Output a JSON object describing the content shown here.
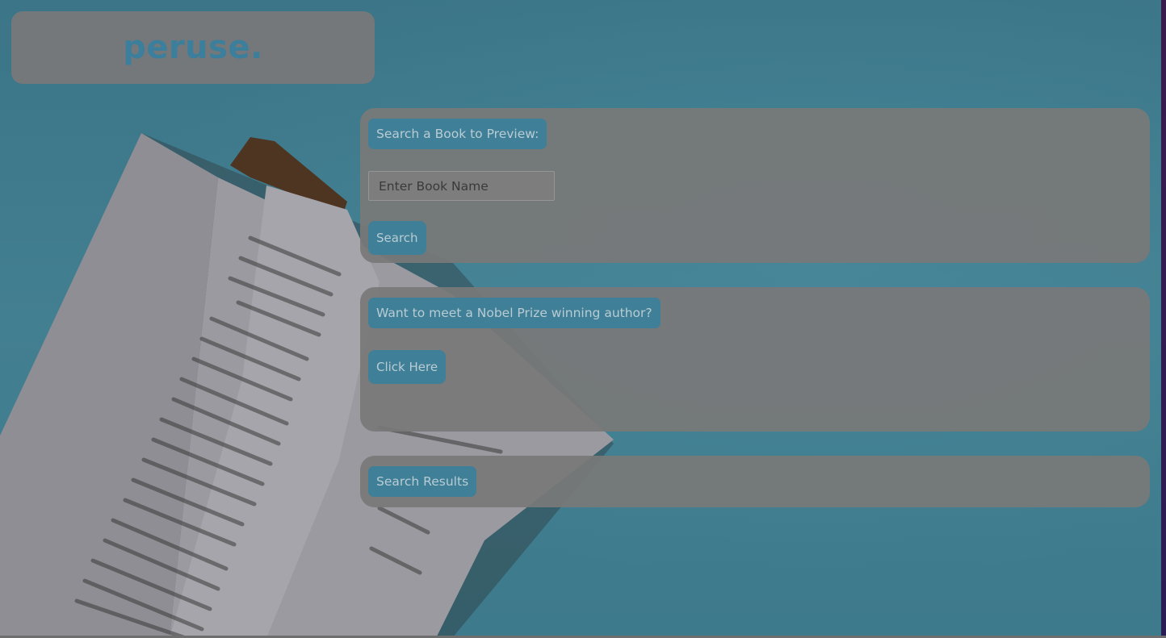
{
  "logo": {
    "text": "peruse."
  },
  "search": {
    "heading": "Search a Book to Preview:",
    "placeholder": "Enter Book Name",
    "value": "",
    "button_label": "Search"
  },
  "nobel": {
    "heading": "Want to meet a Nobel Prize winning author?",
    "button_label": "Click Here"
  },
  "results": {
    "heading": "Search Results"
  },
  "colors": {
    "accent": "#3f7f97",
    "panel": "#787878",
    "logo": "#3b7f9c"
  }
}
